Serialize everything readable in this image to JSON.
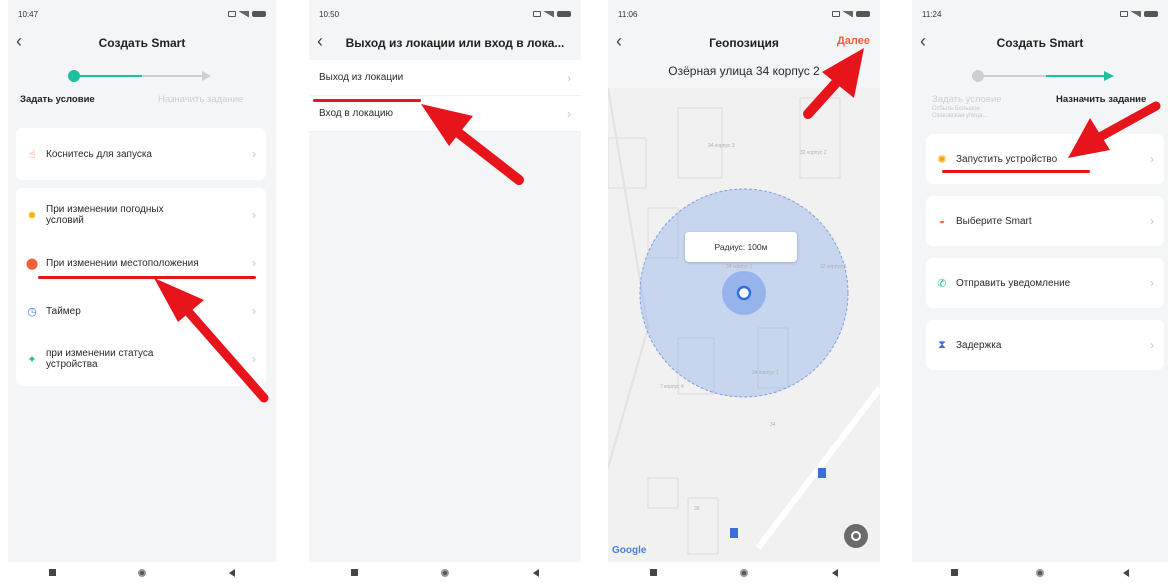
{
  "accent_color": "#1dc19c",
  "annotation_color": "#e8141b",
  "screens": [
    {
      "time": "10:47",
      "title": "Создать Smart",
      "step1": "Задать условие",
      "step2": "Назначить задание",
      "items": [
        {
          "label": "Коснитесь для запуска",
          "icon": "hand-icon"
        },
        {
          "label": "При изменении погодных условий",
          "icon": "sun-icon"
        },
        {
          "label": "При изменении местоположения",
          "icon": "location-pin-icon"
        },
        {
          "label": "Таймер",
          "icon": "clock-icon"
        },
        {
          "label": "при изменении статуса устройства",
          "icon": "device-icon"
        }
      ]
    },
    {
      "time": "10:50",
      "title": "Выход из локации или вход в лока...",
      "items": [
        {
          "label": "Выход из локации"
        },
        {
          "label": "Вход в локацию"
        }
      ]
    },
    {
      "time": "11:06",
      "title": "Геопозиция",
      "next": "Далее",
      "address": "Озёрная улица 34 корпус 2",
      "radius": "Радиус: 100м",
      "map_labels": [
        "34 корпус 3",
        "32 корпус 2",
        "34 корпус 2",
        "32 корпус 1",
        "7 корпус 4",
        "34 корпус 1",
        "34",
        "36"
      ],
      "google": "Google"
    },
    {
      "time": "11:24",
      "title": "Создать Smart",
      "step1": "Задать условие",
      "step1_sub": "Отбыть Большое Озаковская улица...",
      "step2": "Назначить задание",
      "items": [
        {
          "label": "Запустить устройство",
          "icon": "device-icon"
        },
        {
          "label": "Выберите Smart",
          "icon": "sunrise-icon"
        },
        {
          "label": "Отправить уведомление",
          "icon": "phone-icon"
        },
        {
          "label": "Задержка",
          "icon": "hourglass-icon"
        }
      ]
    }
  ]
}
